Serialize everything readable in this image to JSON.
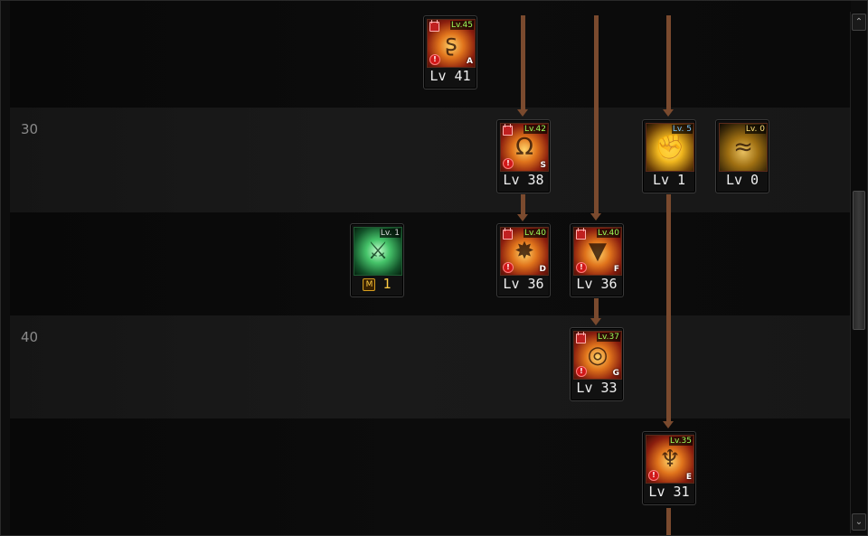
{
  "tree": {
    "row_labels": [
      "30",
      "40"
    ],
    "skills": [
      {
        "id": "a",
        "level": "Lv 41",
        "req": "Lv.45",
        "hotkey": "A",
        "color": "red",
        "locked": true,
        "warn": true,
        "icon": "swirl-fire-icon",
        "glyph": "ʂ"
      },
      {
        "id": "s",
        "level": "Lv 38",
        "req": "Lv.42",
        "hotkey": "S",
        "color": "red",
        "locked": true,
        "warn": true,
        "icon": "horn-slash-icon",
        "glyph": "Ω"
      },
      {
        "id": "buff-blue",
        "level": "Lv 1",
        "req": "Lv. 5",
        "hotkey": "",
        "color": "yellow",
        "locked": false,
        "warn": false,
        "icon": "fist-aura-icon",
        "glyph": "✊",
        "tag_color": "blue"
      },
      {
        "id": "buff-gold",
        "level": "Lv 0",
        "req": "Lv. 0",
        "hotkey": "",
        "color": "dim",
        "locked": false,
        "warn": false,
        "icon": "ground-wave-icon",
        "glyph": "≈",
        "tag_color": "gold"
      },
      {
        "id": "mastery",
        "level": "1",
        "req": "Lv. 1",
        "hotkey": "",
        "color": "green",
        "locked": false,
        "warn": false,
        "icon": "green-blade-icon",
        "glyph": "⚔",
        "tag_color": "white",
        "mastery_badge": "M"
      },
      {
        "id": "d",
        "level": "Lv 36",
        "req": "Lv.40",
        "hotkey": "D",
        "color": "red",
        "locked": true,
        "warn": true,
        "icon": "burst-icon",
        "glyph": "✸"
      },
      {
        "id": "f",
        "level": "Lv 36",
        "req": "Lv.40",
        "hotkey": "F",
        "color": "red",
        "locked": true,
        "warn": true,
        "icon": "eruption-icon",
        "glyph": "▼"
      },
      {
        "id": "g",
        "level": "Lv 33",
        "req": "Lv.37",
        "hotkey": "G",
        "color": "red",
        "locked": true,
        "warn": true,
        "icon": "vortex-icon",
        "glyph": "◎"
      },
      {
        "id": "e",
        "level": "Lv 31",
        "req": "Lv.35",
        "hotkey": "E",
        "color": "red",
        "locked": true,
        "warn": true,
        "icon": "spike-burst-icon",
        "glyph": "♆"
      }
    ]
  },
  "colors": {
    "connector": "#7a4a2e",
    "req_tag_green": "#9cff5a"
  },
  "scrollbar": {
    "up_icon": "chevron-up-icon",
    "down_icon": "chevron-down-icon",
    "up_glyph": "⌃",
    "down_glyph": "⌄"
  }
}
